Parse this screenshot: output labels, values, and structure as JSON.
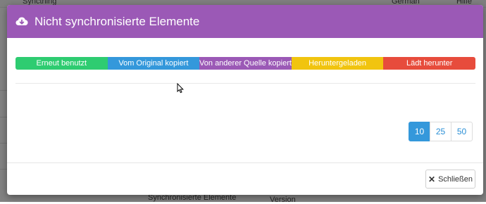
{
  "background": {
    "topbar": {
      "left": "Syncthing",
      "language": "German",
      "help": "Hilfe"
    },
    "footer_text": "Synchronisierte Elemente",
    "footer_right": "Version"
  },
  "modal": {
    "title": "Nicht synchronisierte Elemente",
    "header_icon": "cloud-download-icon",
    "header_color": "#9b59b6",
    "legend": [
      {
        "label": "Erneut benutzt",
        "color": "#2ecc71"
      },
      {
        "label": "Vom Original kopiert",
        "color": "#3498db"
      },
      {
        "label": "Von anderer Quelle kopiert",
        "color": "#9b59b6"
      },
      {
        "label": "Heruntergeladen",
        "color": "#f1c40f"
      },
      {
        "label": "Lädt herunter",
        "color": "#e74c3c"
      }
    ],
    "page_sizes": [
      {
        "label": "10",
        "active": true
      },
      {
        "label": "25",
        "active": false
      },
      {
        "label": "50",
        "active": false
      }
    ],
    "close_label": "Schließen"
  }
}
